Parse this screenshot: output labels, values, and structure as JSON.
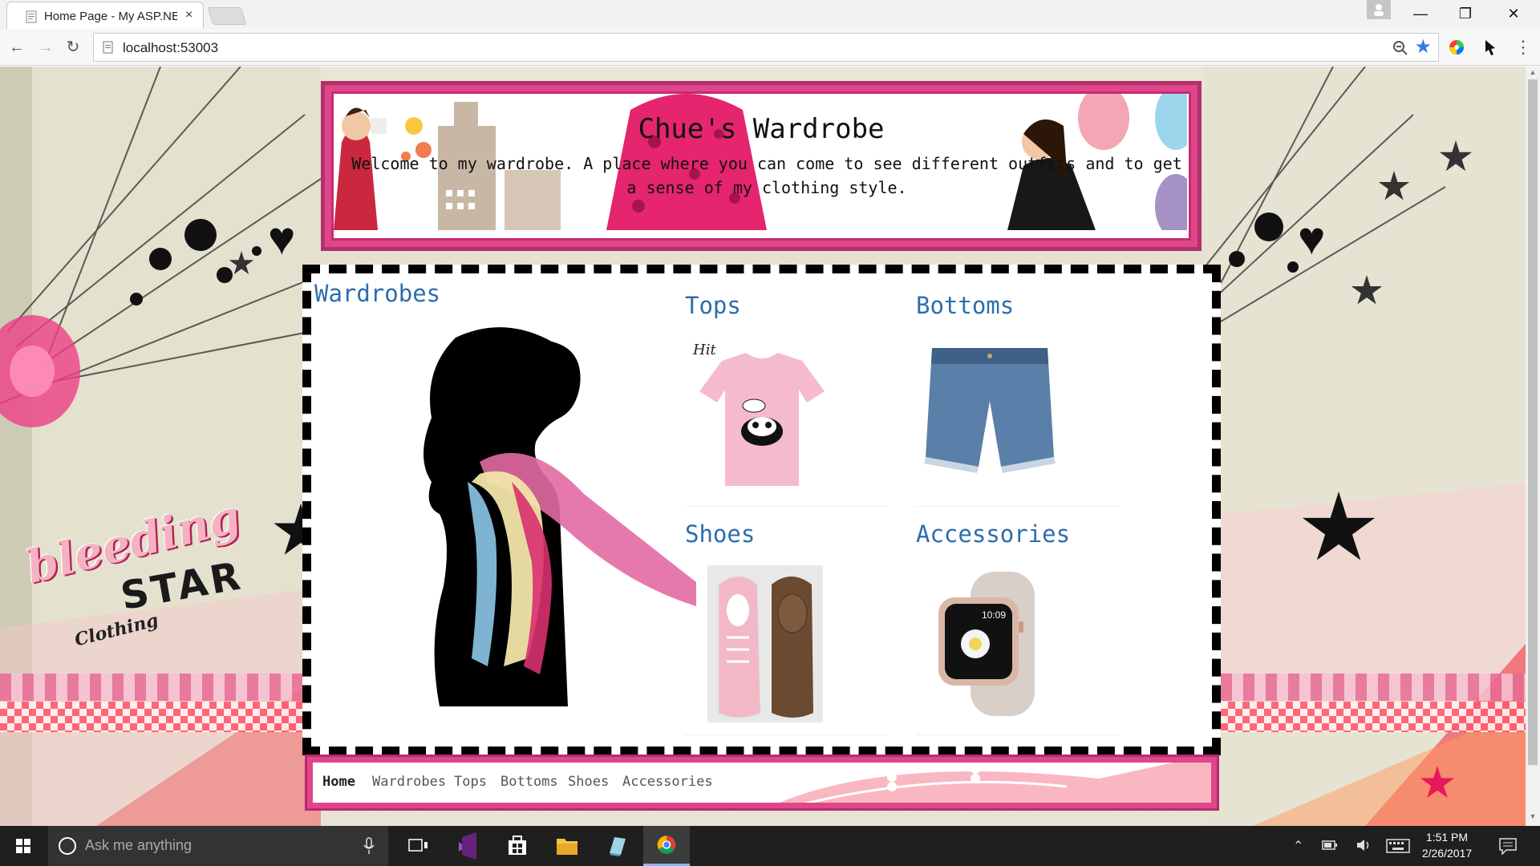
{
  "browser": {
    "tab_title": "Home Page - My ASP.NE",
    "tab_close": "×",
    "url": "localhost:53003",
    "window_controls": {
      "minimize": "—",
      "restore": "❐",
      "close": "✕"
    }
  },
  "header": {
    "title": "Chue's Wardrobe",
    "subtitle": "Welcome to my wardrobe. A place where you can come to see different outfits and to get a sense of my clothing style."
  },
  "main": {
    "wardrobes_title": "Wardrobes",
    "categories": [
      {
        "label": "Tops",
        "icon": "pink-tshirt-image"
      },
      {
        "label": "Bottoms",
        "icon": "denim-shorts-image"
      },
      {
        "label": "Shoes",
        "icon": "pink-sneakers-image"
      },
      {
        "label": "Accessories",
        "icon": "smartwatch-image"
      }
    ]
  },
  "nav": {
    "items": [
      "Home",
      "Wardrobes",
      "Tops",
      "Bottoms",
      "Shoes",
      "Accessories"
    ],
    "active": "Home"
  },
  "background": {
    "brand_text_1": "bleeding",
    "brand_text_2": "STAR",
    "brand_text_3": "Clothing"
  },
  "taskbar": {
    "search_placeholder": "Ask me anything",
    "time": "1:51 PM",
    "date": "2/26/2017"
  },
  "colors": {
    "accent_pink": "#e0468a",
    "title_blue": "#2c6dad"
  }
}
